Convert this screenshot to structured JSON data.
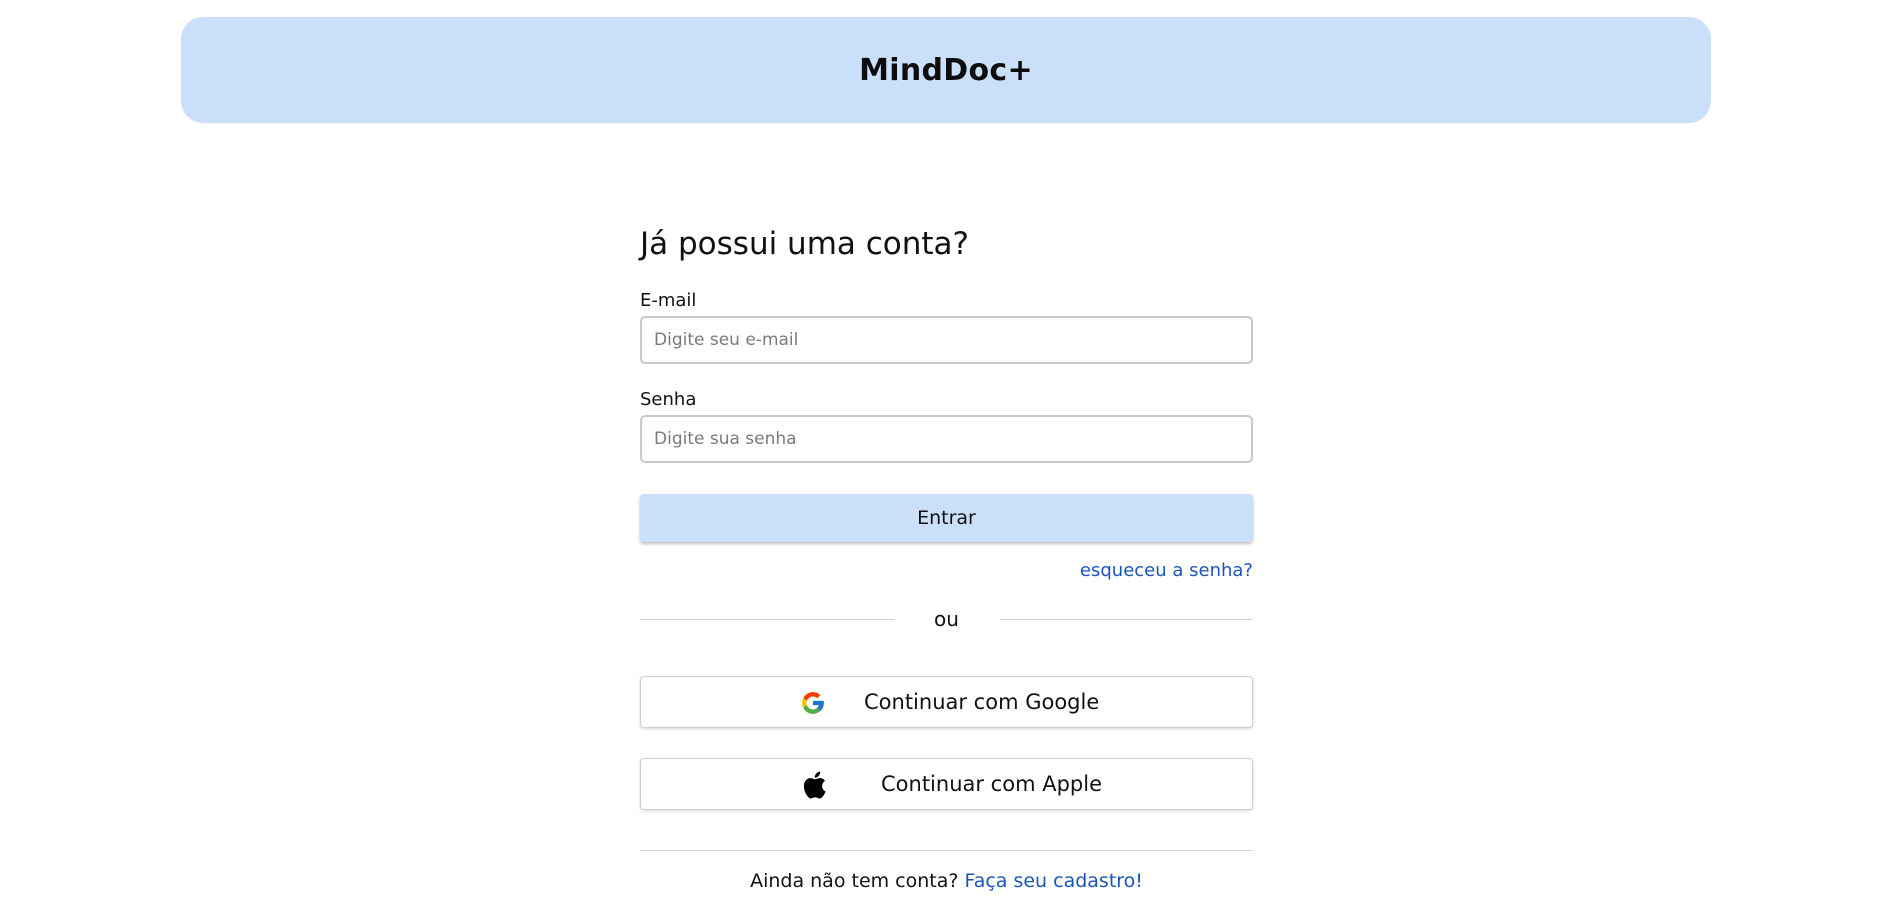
{
  "header": {
    "brand": "MindDoc+"
  },
  "login": {
    "heading": "Já possui uma conta?",
    "email_label": "E-mail",
    "email_placeholder": "Digite seu e-mail",
    "email_value": "",
    "password_label": "Senha",
    "password_placeholder": "Digite sua senha",
    "password_value": "",
    "submit_label": "Entrar",
    "forgot_link": "esqueceu a senha?",
    "divider_text": "ou",
    "google_label": "Continuar com Google",
    "google_icon": "google-icon",
    "apple_label": "Continuar com Apple",
    "apple_icon": "apple-icon",
    "signup_prompt": "Ainda não tem conta?",
    "signup_link": "Faça seu cadastro!"
  },
  "colors": {
    "accent": "#cadffa",
    "link": "#1a56b8",
    "border": "#c9c9c9"
  }
}
